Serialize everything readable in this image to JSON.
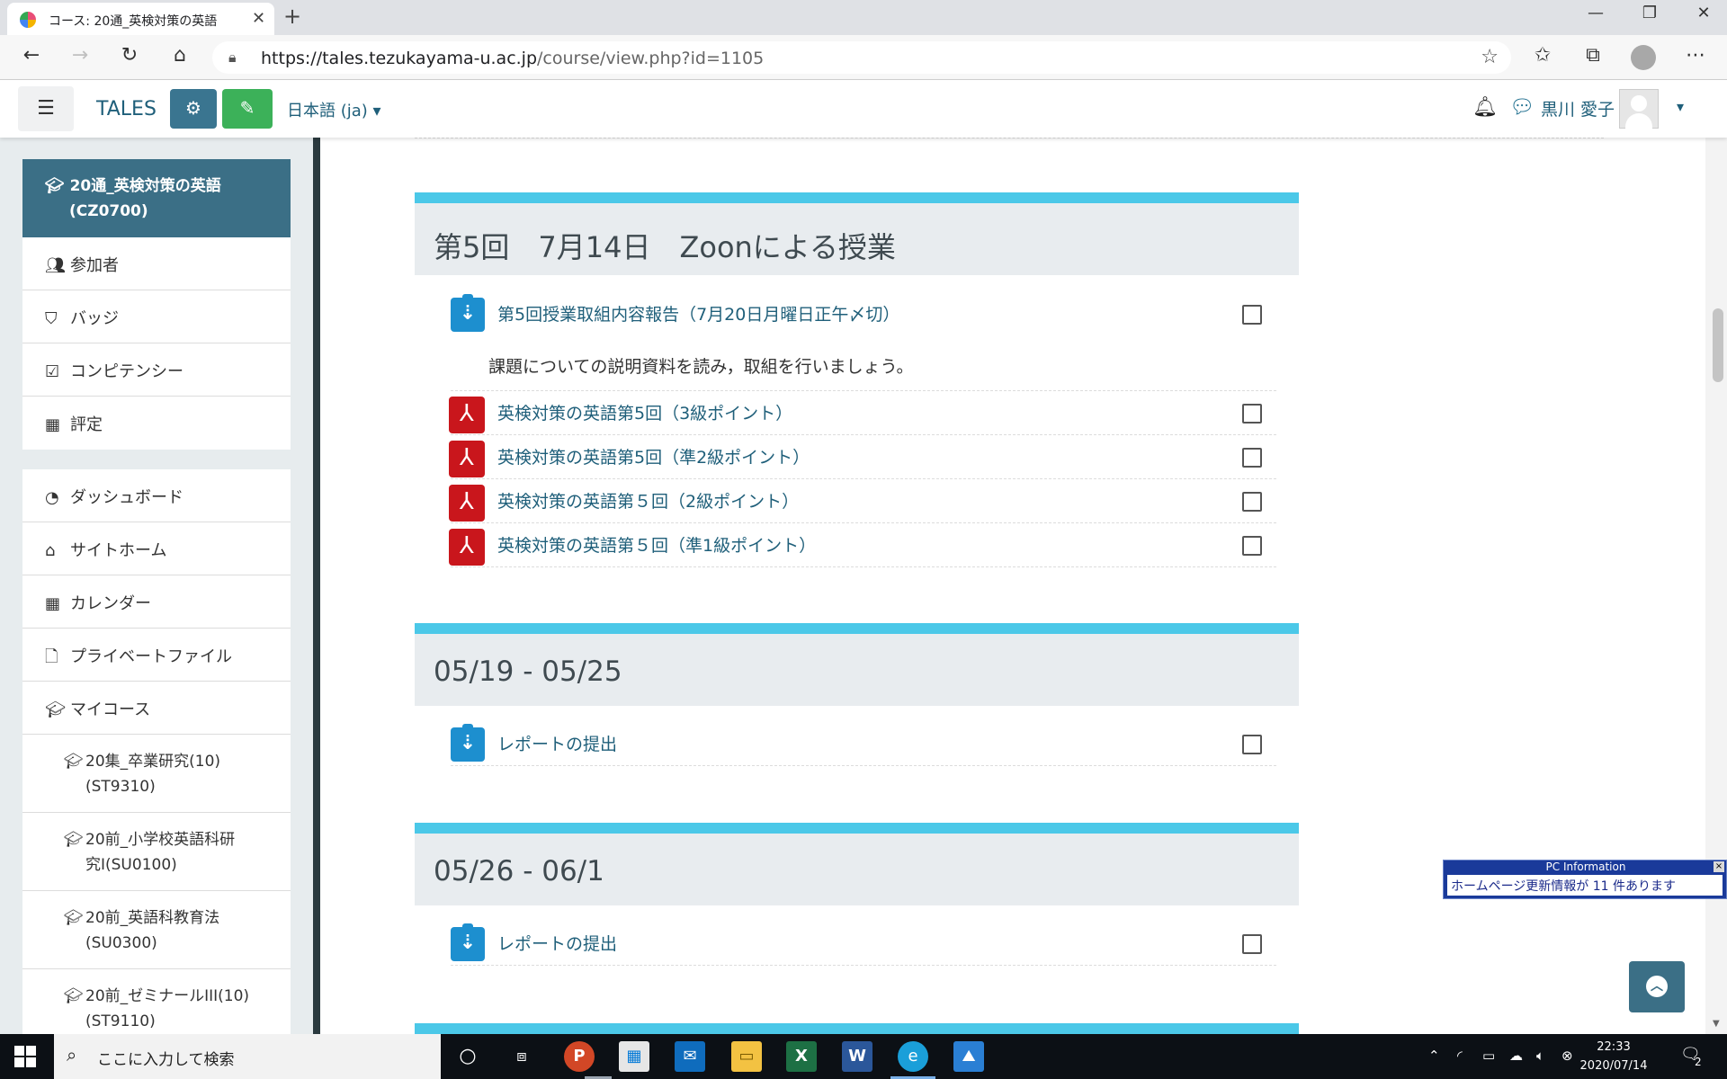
{
  "browser": {
    "tab_title": "コース: 20通_英検対策の英語",
    "tab_close": "✕",
    "new_tab": "+",
    "window_controls": {
      "minimize": "—",
      "maximize": "❐",
      "close": "✕"
    },
    "url_host": "https://tales.tezukayama-u.ac.jp",
    "url_path": "/course/view.php?id=1105",
    "icons": [
      "back-icon",
      "forward-icon",
      "refresh-icon",
      "home-icon",
      "lock-icon",
      "star-icon",
      "favorites-icon",
      "collections-icon",
      "profile-icon",
      "more-icon"
    ]
  },
  "navbar": {
    "brand": "TALES",
    "language": "日本語 (ja)",
    "user_name": "黒川 愛子",
    "colors": {
      "cog_button": "#3a7590",
      "edit_button": "#3cb159",
      "link": "#1f5f7a"
    }
  },
  "drawer": {
    "course": {
      "name": "20通_英検対策の英語",
      "code": "(CZ0700)"
    },
    "course_items": [
      {
        "label": "参加者",
        "icon": "users-icon"
      },
      {
        "label": "バッジ",
        "icon": "shield-icon"
      },
      {
        "label": "コンピテンシー",
        "icon": "checkbox-icon"
      },
      {
        "label": "評定",
        "icon": "table-icon"
      }
    ],
    "site_items": [
      {
        "label": "ダッシュボード",
        "icon": "dashboard-icon"
      },
      {
        "label": "サイトホーム",
        "icon": "house-icon"
      },
      {
        "label": "カレンダー",
        "icon": "calendar-icon"
      },
      {
        "label": "プライベートファイル",
        "icon": "file-icon"
      },
      {
        "label": "マイコース",
        "icon": "graduation-cap-icon"
      }
    ],
    "my_courses": [
      {
        "line1": "20集_卒業研究(10)",
        "line2": "(ST9310)"
      },
      {
        "line1": "20前_小学校英語科研",
        "line2": "究I(SU0100)"
      },
      {
        "line1": "20前_英語科教育法",
        "line2": "(SU0300)"
      },
      {
        "line1": "20前_ゼミナールIII(10)",
        "line2": "(ST9110)"
      }
    ]
  },
  "sections": [
    {
      "title": "第5回　7月14日　Zoonによる授業",
      "activities": [
        {
          "type": "assignment",
          "label": "第5回授業取組内容報告（7月20日月曜日正午〆切）"
        }
      ],
      "description": "課題についての説明資料を読み，取組を行いましょう。",
      "resources": [
        {
          "type": "pdf",
          "label": "英検対策の英語第5回（3級ポイント）"
        },
        {
          "type": "pdf",
          "label": "英検対策の英語第5回（準2級ポイント）"
        },
        {
          "type": "pdf",
          "label": "英検対策の英語第５回（2級ポイント）"
        },
        {
          "type": "pdf",
          "label": "英検対策の英語第５回（準1級ポイント）"
        }
      ]
    },
    {
      "title": "05/19 - 05/25",
      "activities": [
        {
          "type": "assignment",
          "label": "レポートの提出"
        }
      ]
    },
    {
      "title": "05/26 - 06/1",
      "activities": [
        {
          "type": "assignment",
          "label": "レポートの提出"
        }
      ]
    }
  ],
  "colors": {
    "section_accent": "#4bc8e8",
    "section_bg": "#e8ecef",
    "course_header": "#3b6f86",
    "pdf": "#c9161c",
    "assign": "#1d8fcf"
  },
  "pc_info": {
    "title": "PC  Information",
    "message": "ホームページ更新情報が 11 件あります"
  },
  "taskbar": {
    "search_placeholder": "ここに入力して検索",
    "time": "22:33",
    "date": "2020/07/14",
    "notification_count": "2",
    "apps": [
      "cortana-icon",
      "task-view-icon",
      "powerpoint-icon",
      "store-icon",
      "mail-icon",
      "file-explorer-icon",
      "excel-icon",
      "word-icon",
      "edge-icon",
      "photos-icon"
    ]
  }
}
